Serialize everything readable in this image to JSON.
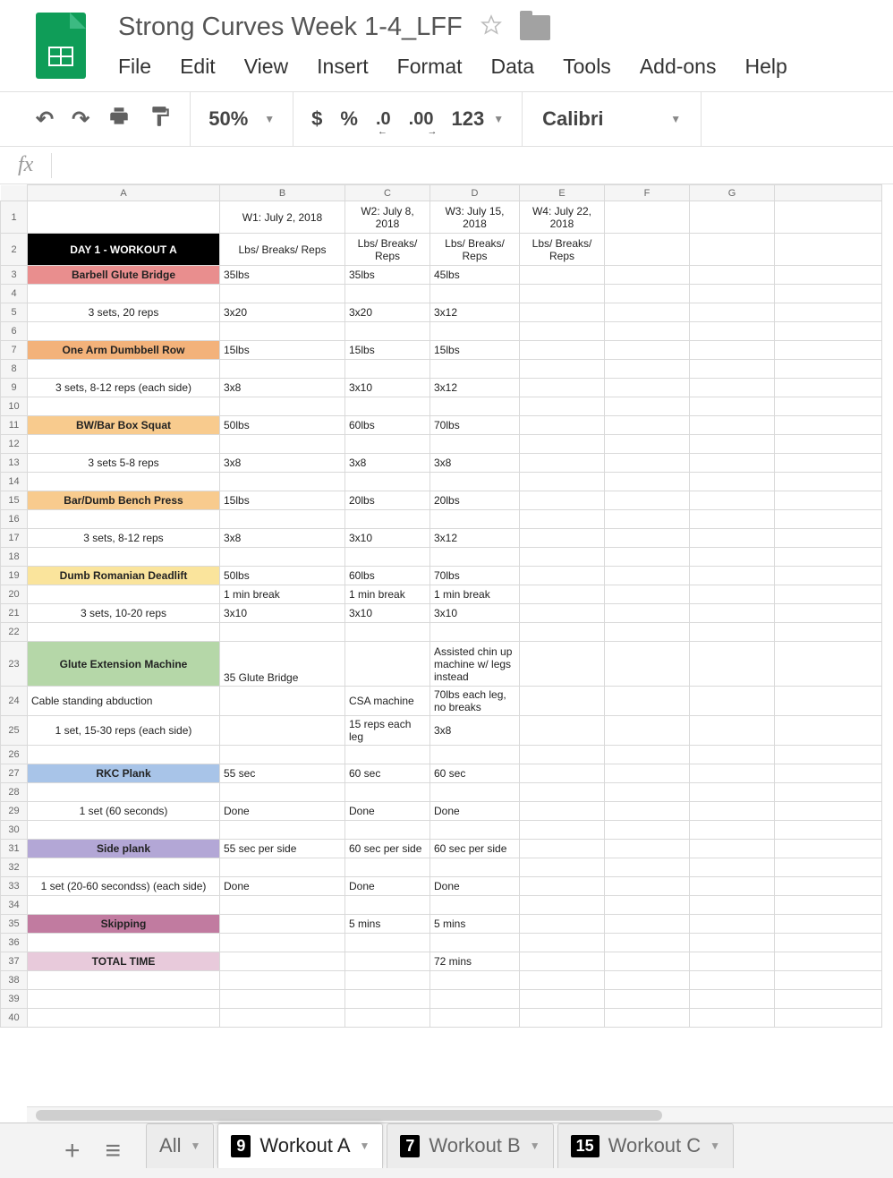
{
  "doc": {
    "title": "Strong Curves Week 1-4_LFF"
  },
  "menu": {
    "file": "File",
    "edit": "Edit",
    "view": "View",
    "insert": "Insert",
    "format": "Format",
    "data": "Data",
    "tools": "Tools",
    "addons": "Add-ons",
    "help": "Help"
  },
  "toolbar": {
    "zoom": "50%",
    "currency": "$",
    "percent": "%",
    "dec0": ".0",
    "dec00": ".00",
    "num123": "123",
    "font": "Calibri"
  },
  "columns": [
    "A",
    "B",
    "C",
    "D",
    "E",
    "F",
    "G",
    ""
  ],
  "rows": [
    {
      "n": "1",
      "h": "tall",
      "cells": [
        {
          "v": "",
          "a": "center"
        },
        {
          "v": "W1: July 2, 2018",
          "a": "center"
        },
        {
          "v": "W2: July 8, 2018",
          "a": "center"
        },
        {
          "v": "W3: July 15, 2018",
          "a": "center"
        },
        {
          "v": "W4: July 22, 2018",
          "a": "center"
        },
        {
          "v": ""
        },
        {
          "v": ""
        },
        {
          "v": ""
        }
      ]
    },
    {
      "n": "2",
      "h": "tall",
      "cells": [
        {
          "v": "DAY 1 - WORKOUT A",
          "cls": "black-cell"
        },
        {
          "v": "Lbs/ Breaks/ Reps",
          "a": "center"
        },
        {
          "v": "Lbs/ Breaks/ Reps",
          "a": "center"
        },
        {
          "v": "Lbs/ Breaks/ Reps",
          "a": "center"
        },
        {
          "v": "Lbs/ Breaks/ Reps",
          "a": "center"
        },
        {
          "v": ""
        },
        {
          "v": ""
        },
        {
          "v": ""
        }
      ]
    },
    {
      "n": "3",
      "cells": [
        {
          "v": "Barbell Glute Bridge",
          "bg": "#e98e8e",
          "b": true
        },
        {
          "v": "35lbs"
        },
        {
          "v": "35lbs"
        },
        {
          "v": "45lbs"
        },
        {
          "v": ""
        },
        {
          "v": ""
        },
        {
          "v": ""
        },
        {
          "v": ""
        }
      ]
    },
    {
      "n": "4",
      "cells": [
        {
          "v": ""
        },
        {
          "v": ""
        },
        {
          "v": ""
        },
        {
          "v": ""
        },
        {
          "v": ""
        },
        {
          "v": ""
        },
        {
          "v": ""
        },
        {
          "v": ""
        }
      ]
    },
    {
      "n": "5",
      "cells": [
        {
          "v": "3 sets, 20 reps"
        },
        {
          "v": "3x20"
        },
        {
          "v": "3x20"
        },
        {
          "v": "3x12"
        },
        {
          "v": ""
        },
        {
          "v": ""
        },
        {
          "v": ""
        },
        {
          "v": ""
        }
      ]
    },
    {
      "n": "6",
      "cells": [
        {
          "v": ""
        },
        {
          "v": ""
        },
        {
          "v": ""
        },
        {
          "v": ""
        },
        {
          "v": ""
        },
        {
          "v": ""
        },
        {
          "v": ""
        },
        {
          "v": ""
        }
      ]
    },
    {
      "n": "7",
      "cells": [
        {
          "v": "One Arm Dumbbell Row",
          "bg": "#f3b27a",
          "b": true
        },
        {
          "v": "15lbs"
        },
        {
          "v": "15lbs"
        },
        {
          "v": "15lbs"
        },
        {
          "v": ""
        },
        {
          "v": ""
        },
        {
          "v": ""
        },
        {
          "v": ""
        }
      ]
    },
    {
      "n": "8",
      "cells": [
        {
          "v": ""
        },
        {
          "v": ""
        },
        {
          "v": ""
        },
        {
          "v": ""
        },
        {
          "v": ""
        },
        {
          "v": ""
        },
        {
          "v": ""
        },
        {
          "v": ""
        }
      ]
    },
    {
      "n": "9",
      "cells": [
        {
          "v": "3 sets, 8-12 reps (each side)"
        },
        {
          "v": "3x8"
        },
        {
          "v": "3x10"
        },
        {
          "v": "3x12"
        },
        {
          "v": ""
        },
        {
          "v": ""
        },
        {
          "v": ""
        },
        {
          "v": ""
        }
      ]
    },
    {
      "n": "10",
      "cells": [
        {
          "v": ""
        },
        {
          "v": ""
        },
        {
          "v": ""
        },
        {
          "v": ""
        },
        {
          "v": ""
        },
        {
          "v": ""
        },
        {
          "v": ""
        },
        {
          "v": ""
        }
      ]
    },
    {
      "n": "11",
      "cells": [
        {
          "v": "BW/Bar Box Squat",
          "bg": "#f8cb8e",
          "b": true
        },
        {
          "v": "50lbs"
        },
        {
          "v": "60lbs"
        },
        {
          "v": "70lbs"
        },
        {
          "v": ""
        },
        {
          "v": ""
        },
        {
          "v": ""
        },
        {
          "v": ""
        }
      ]
    },
    {
      "n": "12",
      "cells": [
        {
          "v": ""
        },
        {
          "v": ""
        },
        {
          "v": ""
        },
        {
          "v": ""
        },
        {
          "v": ""
        },
        {
          "v": ""
        },
        {
          "v": ""
        },
        {
          "v": ""
        }
      ]
    },
    {
      "n": "13",
      "cells": [
        {
          "v": "3 sets 5-8 reps"
        },
        {
          "v": "3x8"
        },
        {
          "v": "3x8"
        },
        {
          "v": "3x8"
        },
        {
          "v": ""
        },
        {
          "v": ""
        },
        {
          "v": ""
        },
        {
          "v": ""
        }
      ]
    },
    {
      "n": "14",
      "cells": [
        {
          "v": ""
        },
        {
          "v": ""
        },
        {
          "v": ""
        },
        {
          "v": ""
        },
        {
          "v": ""
        },
        {
          "v": ""
        },
        {
          "v": ""
        },
        {
          "v": ""
        }
      ]
    },
    {
      "n": "15",
      "cells": [
        {
          "v": "Bar/Dumb Bench Press",
          "bg": "#f8cb8e",
          "b": true
        },
        {
          "v": "15lbs"
        },
        {
          "v": "20lbs"
        },
        {
          "v": "20lbs"
        },
        {
          "v": ""
        },
        {
          "v": ""
        },
        {
          "v": ""
        },
        {
          "v": ""
        }
      ]
    },
    {
      "n": "16",
      "cells": [
        {
          "v": ""
        },
        {
          "v": ""
        },
        {
          "v": ""
        },
        {
          "v": ""
        },
        {
          "v": ""
        },
        {
          "v": ""
        },
        {
          "v": ""
        },
        {
          "v": ""
        }
      ]
    },
    {
      "n": "17",
      "cells": [
        {
          "v": "3 sets, 8-12 reps"
        },
        {
          "v": "3x8"
        },
        {
          "v": "3x10"
        },
        {
          "v": "3x12"
        },
        {
          "v": ""
        },
        {
          "v": ""
        },
        {
          "v": ""
        },
        {
          "v": ""
        }
      ]
    },
    {
      "n": "18",
      "cells": [
        {
          "v": ""
        },
        {
          "v": ""
        },
        {
          "v": ""
        },
        {
          "v": ""
        },
        {
          "v": ""
        },
        {
          "v": ""
        },
        {
          "v": ""
        },
        {
          "v": ""
        }
      ]
    },
    {
      "n": "19",
      "cells": [
        {
          "v": "Dumb Romanian Deadlift",
          "bg": "#fae49c",
          "b": true
        },
        {
          "v": "50lbs"
        },
        {
          "v": "60lbs"
        },
        {
          "v": "70lbs"
        },
        {
          "v": ""
        },
        {
          "v": ""
        },
        {
          "v": ""
        },
        {
          "v": ""
        }
      ]
    },
    {
      "n": "20",
      "cells": [
        {
          "v": ""
        },
        {
          "v": "1 min break"
        },
        {
          "v": "1 min break"
        },
        {
          "v": "1 min break"
        },
        {
          "v": ""
        },
        {
          "v": ""
        },
        {
          "v": ""
        },
        {
          "v": ""
        }
      ]
    },
    {
      "n": "21",
      "cells": [
        {
          "v": "3 sets, 10-20 reps"
        },
        {
          "v": "3x10"
        },
        {
          "v": "3x10"
        },
        {
          "v": "3x10"
        },
        {
          "v": ""
        },
        {
          "v": ""
        },
        {
          "v": ""
        },
        {
          "v": ""
        }
      ]
    },
    {
      "n": "22",
      "cells": [
        {
          "v": ""
        },
        {
          "v": ""
        },
        {
          "v": ""
        },
        {
          "v": ""
        },
        {
          "v": ""
        },
        {
          "v": ""
        },
        {
          "v": ""
        },
        {
          "v": ""
        }
      ]
    },
    {
      "n": "23",
      "h": "tall2",
      "cells": [
        {
          "v": "Glute Extension Machine",
          "bg": "#b5d7a8",
          "b": true
        },
        {
          "v": "35 Glute Bridge",
          "va": "bottom"
        },
        {
          "v": ""
        },
        {
          "v": "Assisted chin up machine w/ legs instead"
        },
        {
          "v": ""
        },
        {
          "v": ""
        },
        {
          "v": ""
        },
        {
          "v": ""
        }
      ]
    },
    {
      "n": "24",
      "cells": [
        {
          "v": "Cable standing abduction",
          "a": "left"
        },
        {
          "v": ""
        },
        {
          "v": "CSA machine"
        },
        {
          "v": "70lbs each leg, no breaks"
        },
        {
          "v": ""
        },
        {
          "v": ""
        },
        {
          "v": ""
        },
        {
          "v": ""
        }
      ]
    },
    {
      "n": "25",
      "cells": [
        {
          "v": "1 set, 15-30 reps (each side)"
        },
        {
          "v": ""
        },
        {
          "v": "15 reps each leg"
        },
        {
          "v": "3x8"
        },
        {
          "v": ""
        },
        {
          "v": ""
        },
        {
          "v": ""
        },
        {
          "v": ""
        }
      ]
    },
    {
      "n": "26",
      "cells": [
        {
          "v": ""
        },
        {
          "v": ""
        },
        {
          "v": ""
        },
        {
          "v": ""
        },
        {
          "v": ""
        },
        {
          "v": ""
        },
        {
          "v": ""
        },
        {
          "v": ""
        }
      ]
    },
    {
      "n": "27",
      "cells": [
        {
          "v": "RKC Plank",
          "bg": "#a8c4e8",
          "b": true
        },
        {
          "v": "55 sec"
        },
        {
          "v": "60 sec"
        },
        {
          "v": "60 sec"
        },
        {
          "v": ""
        },
        {
          "v": ""
        },
        {
          "v": ""
        },
        {
          "v": ""
        }
      ]
    },
    {
      "n": "28",
      "cells": [
        {
          "v": ""
        },
        {
          "v": ""
        },
        {
          "v": ""
        },
        {
          "v": ""
        },
        {
          "v": ""
        },
        {
          "v": ""
        },
        {
          "v": ""
        },
        {
          "v": ""
        }
      ]
    },
    {
      "n": "29",
      "cells": [
        {
          "v": "1 set (60 seconds)"
        },
        {
          "v": "Done"
        },
        {
          "v": "Done"
        },
        {
          "v": "Done"
        },
        {
          "v": ""
        },
        {
          "v": ""
        },
        {
          "v": ""
        },
        {
          "v": ""
        }
      ]
    },
    {
      "n": "30",
      "cells": [
        {
          "v": ""
        },
        {
          "v": ""
        },
        {
          "v": ""
        },
        {
          "v": ""
        },
        {
          "v": ""
        },
        {
          "v": ""
        },
        {
          "v": ""
        },
        {
          "v": ""
        }
      ]
    },
    {
      "n": "31",
      "cells": [
        {
          "v": "Side plank",
          "bg": "#b3a7d6",
          "b": true
        },
        {
          "v": "55 sec per side"
        },
        {
          "v": "60 sec per side"
        },
        {
          "v": "60 sec per side"
        },
        {
          "v": ""
        },
        {
          "v": ""
        },
        {
          "v": ""
        },
        {
          "v": ""
        }
      ]
    },
    {
      "n": "32",
      "cells": [
        {
          "v": ""
        },
        {
          "v": ""
        },
        {
          "v": ""
        },
        {
          "v": ""
        },
        {
          "v": ""
        },
        {
          "v": ""
        },
        {
          "v": ""
        },
        {
          "v": ""
        }
      ]
    },
    {
      "n": "33",
      "cells": [
        {
          "v": "1 set (20-60 secondss) (each side)"
        },
        {
          "v": "Done"
        },
        {
          "v": "Done"
        },
        {
          "v": "Done"
        },
        {
          "v": ""
        },
        {
          "v": ""
        },
        {
          "v": ""
        },
        {
          "v": ""
        }
      ]
    },
    {
      "n": "34",
      "cells": [
        {
          "v": ""
        },
        {
          "v": ""
        },
        {
          "v": ""
        },
        {
          "v": ""
        },
        {
          "v": ""
        },
        {
          "v": ""
        },
        {
          "v": ""
        },
        {
          "v": ""
        }
      ]
    },
    {
      "n": "35",
      "cells": [
        {
          "v": "Skipping",
          "bg": "#c17ba0",
          "b": true
        },
        {
          "v": ""
        },
        {
          "v": "5 mins"
        },
        {
          "v": "5 mins"
        },
        {
          "v": ""
        },
        {
          "v": ""
        },
        {
          "v": ""
        },
        {
          "v": ""
        }
      ]
    },
    {
      "n": "36",
      "cells": [
        {
          "v": ""
        },
        {
          "v": ""
        },
        {
          "v": ""
        },
        {
          "v": ""
        },
        {
          "v": ""
        },
        {
          "v": ""
        },
        {
          "v": ""
        },
        {
          "v": ""
        }
      ]
    },
    {
      "n": "37",
      "cells": [
        {
          "v": "TOTAL TIME",
          "bg": "#e8cadb",
          "b": true
        },
        {
          "v": ""
        },
        {
          "v": ""
        },
        {
          "v": "72 mins"
        },
        {
          "v": ""
        },
        {
          "v": ""
        },
        {
          "v": ""
        },
        {
          "v": ""
        }
      ]
    },
    {
      "n": "38",
      "cells": [
        {
          "v": ""
        },
        {
          "v": ""
        },
        {
          "v": ""
        },
        {
          "v": ""
        },
        {
          "v": ""
        },
        {
          "v": ""
        },
        {
          "v": ""
        },
        {
          "v": ""
        }
      ]
    },
    {
      "n": "39",
      "cells": [
        {
          "v": ""
        },
        {
          "v": ""
        },
        {
          "v": ""
        },
        {
          "v": ""
        },
        {
          "v": ""
        },
        {
          "v": ""
        },
        {
          "v": ""
        },
        {
          "v": ""
        }
      ]
    },
    {
      "n": "40",
      "cells": [
        {
          "v": ""
        },
        {
          "v": ""
        },
        {
          "v": ""
        },
        {
          "v": ""
        },
        {
          "v": ""
        },
        {
          "v": ""
        },
        {
          "v": ""
        },
        {
          "v": ""
        }
      ]
    }
  ],
  "sheets": {
    "all": "All",
    "tabs": [
      {
        "badge": "9",
        "label": "Workout A",
        "active": true
      },
      {
        "badge": "7",
        "label": "Workout B",
        "active": false
      },
      {
        "badge": "15",
        "label": "Workout C",
        "active": false
      }
    ]
  }
}
